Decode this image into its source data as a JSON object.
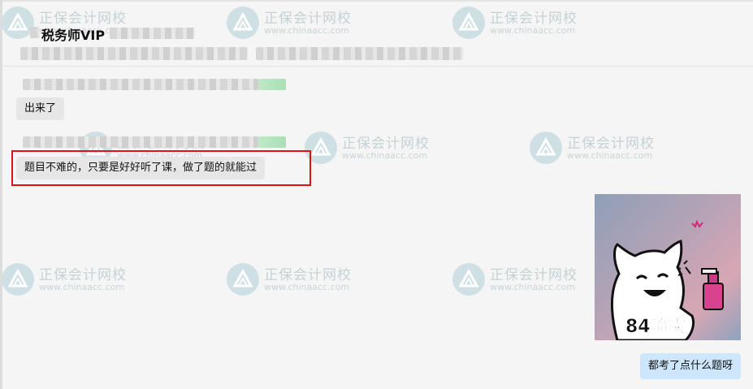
{
  "watermark": {
    "name": "正保会计网校",
    "url": "www.chinaacc.com"
  },
  "header": {
    "title": "税务师VIP"
  },
  "messages": [
    {
      "text": "出来了"
    },
    {
      "text": "题目不难的，只要是好好听了课，做了题的就能过"
    },
    {
      "text": "都考了点什么题呀"
    }
  ],
  "sticker": {
    "caption": "84喷雾"
  },
  "colors": {
    "background": "#f5f5f5",
    "bubble": "#e6e6e6",
    "self_bubble": "#cde6fb",
    "highlight": "#e21212"
  }
}
